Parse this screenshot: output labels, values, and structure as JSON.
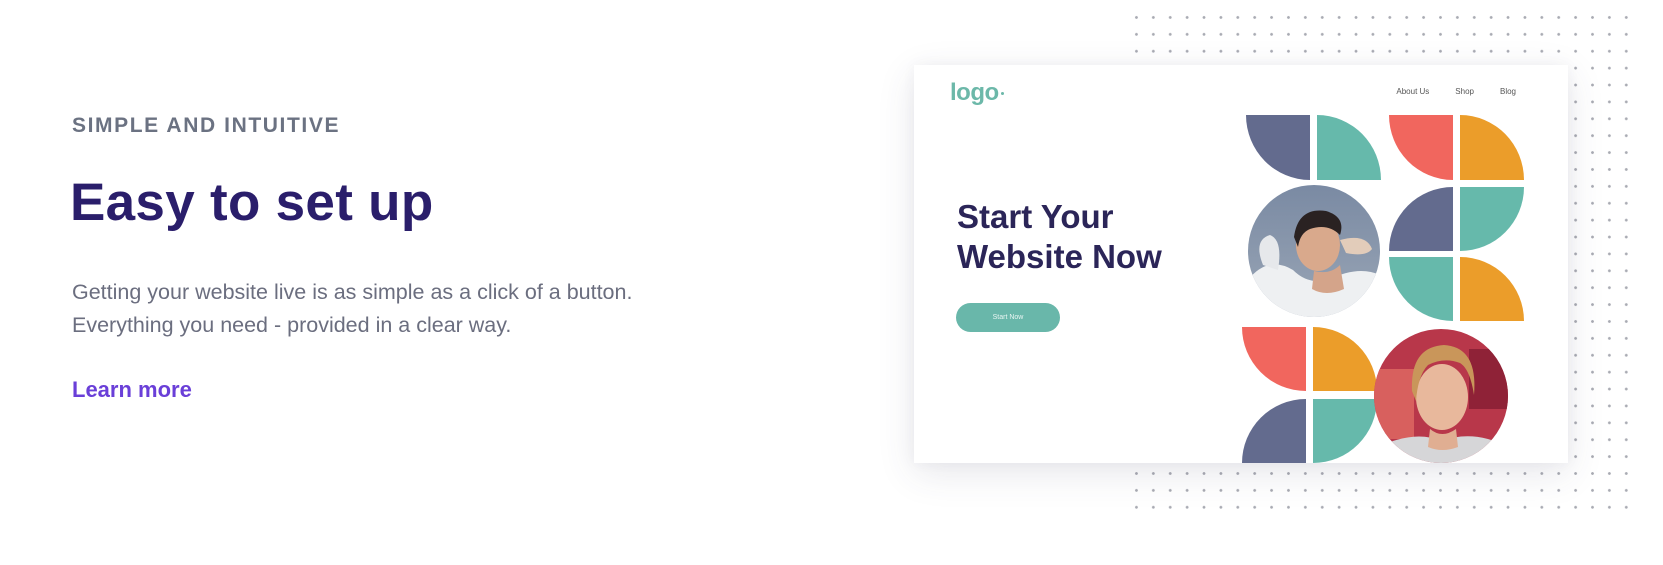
{
  "section": {
    "eyebrow": "SIMPLE AND INTUITIVE",
    "title": "Easy to set up",
    "description_lines": [
      "Getting your website live is as simple as a click of a button.",
      "Everything you need - provided in a clear way."
    ],
    "link_label": "Learn more"
  },
  "preview": {
    "logo": "logo",
    "nav": [
      "About Us",
      "Shop",
      "Blog"
    ],
    "hero_lines": [
      "Start Your",
      "Website Now"
    ],
    "cta_label": "Start Now",
    "photos": [
      {
        "name": "woman-smiling-photo"
      },
      {
        "name": "young-man-photo"
      }
    ]
  },
  "colors": {
    "heading": "#2a1e6b",
    "accent_link": "#6a3fd8",
    "teal": "#66b9ab",
    "navy": "#636b8e",
    "coral": "#f1665e",
    "orange": "#eb9d2a"
  }
}
